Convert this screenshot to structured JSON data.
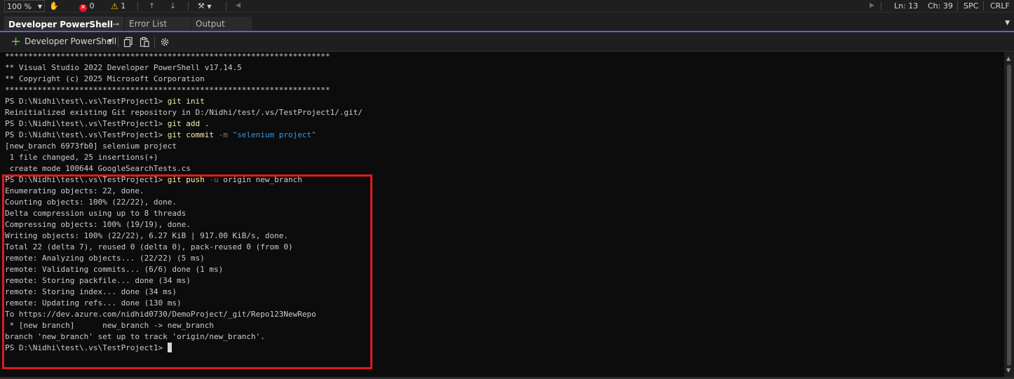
{
  "status_strip": {
    "zoom": "100 %",
    "errors": "0",
    "warnings": "1",
    "line": "Ln: 13",
    "col": "Ch: 39",
    "whitespace": "SPC",
    "line_ending": "CRLF"
  },
  "tabs": [
    {
      "label": "Developer PowerShell",
      "active": true
    },
    {
      "label": "Error List",
      "active": false
    },
    {
      "label": "Output",
      "active": false
    }
  ],
  "toolbar": {
    "new_terminal_label": "Developer PowerShell",
    "icons": [
      "copy-icon",
      "paste-icon",
      "settings-icon"
    ]
  },
  "terminal": {
    "lines": [
      "**********************************************************************",
      "** Visual Studio 2022 Developer PowerShell v17.14.5",
      "** Copyright (c) 2025 Microsoft Corporation",
      "**********************************************************************",
      "PS D:\\Nidhi\\test\\.vs\\TestProject1> ",
      "Reinitialized existing Git repository in D:/Nidhi/test/.vs/TestProject1/.git/",
      "PS D:\\Nidhi\\test\\.vs\\TestProject1> ",
      "PS D:\\Nidhi\\test\\.vs\\TestProject1> ",
      "[new_branch 6973fb0] selenium project",
      " 1 file changed, 25 insertions(+)",
      " create mode 100644 GoogleSearchTests.cs",
      "PS D:\\Nidhi\\test\\.vs\\TestProject1> ",
      "Enumerating objects: 22, done.",
      "Counting objects: 100% (22/22), done.",
      "Delta compression using up to 8 threads",
      "Compressing objects: 100% (19/19), done.",
      "Writing objects: 100% (22/22), 6.27 KiB | 917.00 KiB/s, done.",
      "Total 22 (delta 7), reused 0 (delta 0), pack-reused 0 (from 0)",
      "remote: Analyzing objects... (22/22) (5 ms)",
      "remote: Validating commits... (6/6) done (1 ms)",
      "remote: Storing packfile... done (34 ms)",
      "remote: Storing index... done (34 ms)",
      "remote: Updating refs... done (130 ms)",
      "To https://dev.azure.com/nidhid0730/DemoProject/_git/Repo123NewRepo",
      " * [new branch]      new_branch -> new_branch",
      "branch 'new_branch' set up to track 'origin/new_branch'.",
      "PS D:\\Nidhi\\test\\.vs\\TestProject1> "
    ],
    "commands": {
      "4": [
        {
          "t": "git init",
          "c": "cmd"
        }
      ],
      "6": [
        {
          "t": "git add .",
          "c": "cmd"
        }
      ],
      "7": [
        {
          "t": "git commit",
          "c": "cmd"
        },
        {
          "t": " ",
          "c": ""
        },
        {
          "t": "-m",
          "c": "flag"
        },
        {
          "t": " ",
          "c": ""
        },
        {
          "t": "\"selenium project\"",
          "c": "str"
        }
      ],
      "11": [
        {
          "t": "git push",
          "c": "cmd"
        },
        {
          "t": " ",
          "c": ""
        },
        {
          "t": "-u",
          "c": "flag"
        },
        {
          "t": " origin new_branch",
          "c": ""
        }
      ]
    }
  },
  "colors": {
    "accent": "#6f5bd0",
    "highlight_border": "#e01b1b",
    "command": "#f9f1a5",
    "string": "#3a96dd"
  }
}
